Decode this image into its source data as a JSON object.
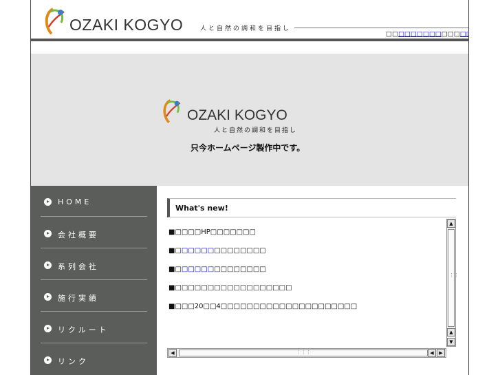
{
  "header": {
    "logo_text": "OZAKI KOGYO",
    "tagline": "人と自然の調和を目指し",
    "topnav": {
      "prefix": "□□",
      "link1": "□□□□□□□",
      "middle": "□□□",
      "link2": "□□□□□□□",
      "suffix": "□"
    }
  },
  "hero": {
    "logo_text": "OZAKI KOGYO",
    "tagline": "人と自然の調和を目指し",
    "message": "只今ホームページ製作中です。"
  },
  "sidebar": {
    "items": [
      {
        "label": "HOME"
      },
      {
        "label": "会社概要"
      },
      {
        "label": "系列会社"
      },
      {
        "label": "施行実績"
      },
      {
        "label": "リクルート"
      },
      {
        "label": "リンク"
      }
    ]
  },
  "news": {
    "title": "What's new!",
    "items": [
      {
        "pre": "■□□□□HP□□□□□□□",
        "link": "",
        "post": ""
      },
      {
        "pre": "■□",
        "link": "□□□□□",
        "post": "□□□□□□□□"
      },
      {
        "pre": "■□",
        "link": "□□□□□",
        "post": "□□□□□□□□"
      },
      {
        "pre": "■□□□□□□□□□□□□□□□□□□",
        "link": "",
        "post": ""
      },
      {
        "pre": "■□□□20□□4□□□□□□□□□□□□□□□□□□□□□",
        "link": "",
        "post": ""
      }
    ]
  },
  "colors": {
    "sidebar_bg": "#5b5d5b",
    "hero_bg": "#e4e4e4",
    "link": "#0000cc"
  }
}
